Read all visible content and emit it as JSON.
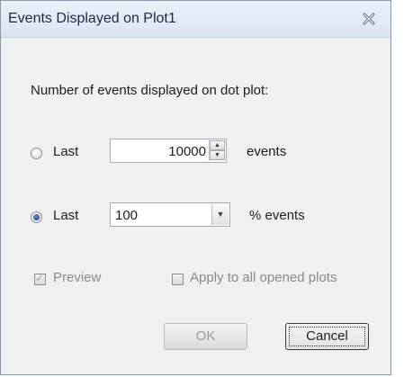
{
  "dialog": {
    "title": "Events Displayed on Plot1",
    "close_icon": "close-icon"
  },
  "content": {
    "heading": "Number of events displayed on dot plot:",
    "option_count": {
      "label": "Last",
      "value": "10000",
      "unit": "events",
      "selected": false
    },
    "option_percent": {
      "label": "Last",
      "value": "100",
      "unit": "% events",
      "selected": true
    },
    "preview": {
      "label": "Preview",
      "checked": true,
      "enabled": false
    },
    "apply_all": {
      "label": "Apply to all opened plots",
      "checked": false,
      "enabled": false
    }
  },
  "buttons": {
    "ok_label": "OK",
    "cancel_label": "Cancel"
  },
  "colors": {
    "title_gradient_top": "#e9f0f9",
    "title_gradient_bottom": "#dbe6f3",
    "body_bg": "#f0f0f0",
    "radio_selected": "#1a3f87"
  }
}
